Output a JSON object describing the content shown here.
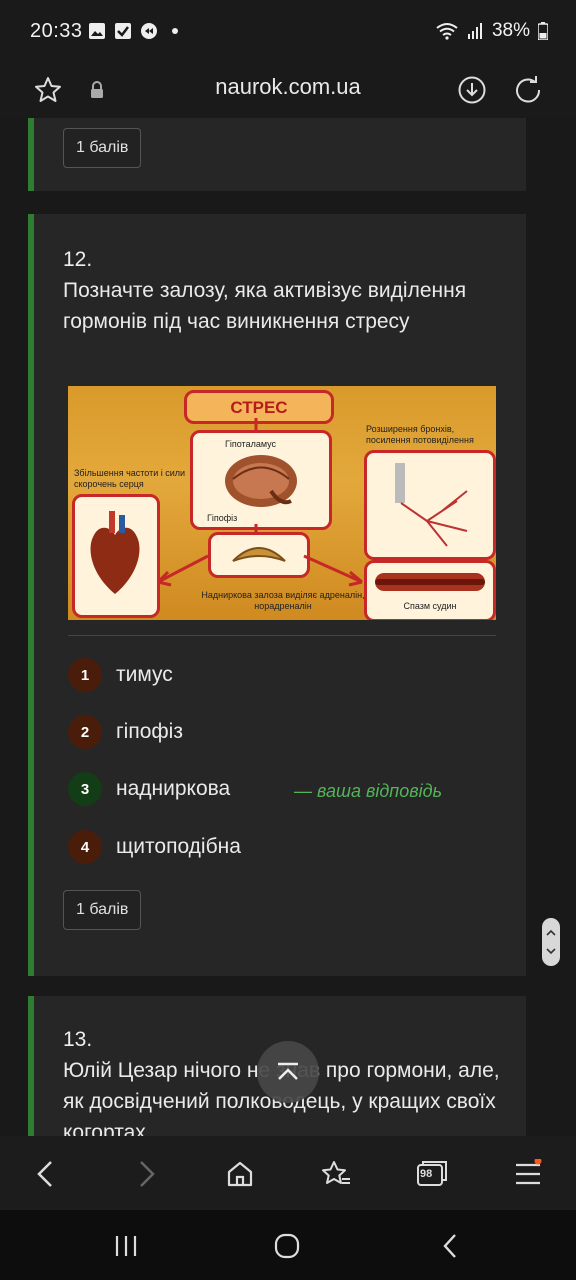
{
  "status": {
    "time": "20:33",
    "battery": "38%"
  },
  "browser": {
    "url": "naurok.com.ua"
  },
  "prev_card": {
    "points": "1 балів"
  },
  "question12": {
    "number": "12.",
    "text": "Позначте залозу, яка активізує виділення гормонів під час виникнення стресу",
    "figure": {
      "title": "СТРЕС",
      "hypothalamus": "Гіпоталамус",
      "pituitary": "Гіпофіз",
      "heart_caption": "Збільшення частоти і сили скорочень серця",
      "bronchi_caption": "Розширення бронхів, посилення потовиділення",
      "adrenal_caption": "Надниркова залоза виділяє адреналін, норадреналін",
      "vessels_caption": "Спазм судин"
    },
    "options": [
      {
        "num": "1",
        "label": "тимус"
      },
      {
        "num": "2",
        "label": "гіпофіз"
      },
      {
        "num": "3",
        "label": "надниркова"
      },
      {
        "num": "4",
        "label": "щитоподібна"
      }
    ],
    "your_answer": "— ваша відповідь",
    "points": "1 балів"
  },
  "question13": {
    "number": "13.",
    "text": "Юлій Цезар нічого не знав про гормони, але, як досвідчений полководець, у кращих своїх когортах"
  },
  "tabs_count": "98",
  "colors": {
    "accent_green": "#2e7d32",
    "answer_green": "#54b45a",
    "badge_brown": "#4a1d0b",
    "badge_green": "#123d16"
  },
  "icons": [
    "star-icon",
    "lock-icon",
    "download-icon",
    "refresh-icon",
    "back-icon",
    "forward-icon",
    "home-icon",
    "bookmarks-icon",
    "tabs-icon",
    "menu-icon",
    "recents-icon",
    "home-circle-icon",
    "nav-back-icon",
    "scroll-top-icon"
  ]
}
